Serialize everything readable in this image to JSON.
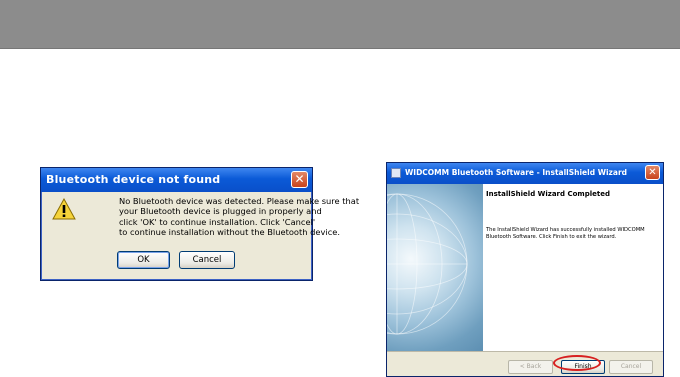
{
  "dialog_not_found": {
    "title": "Bluetooth device not found",
    "message_lines": [
      "No Bluetooth device was detected. Please make sure that",
      "your Bluetooth device is plugged in properly and",
      "click 'OK' to continue installation. Click 'Cancel'",
      "to continue installation without the Bluetooth device."
    ],
    "ok_label": "OK",
    "cancel_label": "Cancel",
    "close_glyph": "✕"
  },
  "wizard": {
    "title": "WIDCOMM Bluetooth Software - InstallShield Wizard",
    "heading": "InstallShield Wizard Completed",
    "body_lines": [
      "The InstallShield Wizard has successfully installed WIDCOMM",
      "Bluetooth Software. Click Finish to exit the wizard."
    ],
    "back_label": "< Back",
    "finish_label": "Finish",
    "cancel_label": "Cancel",
    "close_glyph": "✕"
  },
  "colors": {
    "titlebar": "#0b5ad7",
    "highlight": "#d72020",
    "topbar": "#8c8c8c"
  },
  "icons": [
    "warning-icon",
    "close-icon",
    "globe-image",
    "app-icon"
  ]
}
